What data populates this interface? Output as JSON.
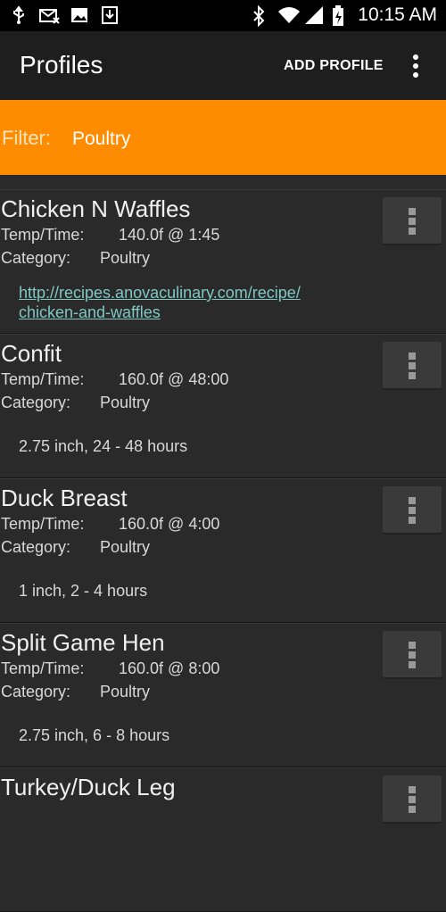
{
  "status_bar": {
    "time": "10:15 AM",
    "left_icons": [
      "usb-icon",
      "mail-icon",
      "image-icon",
      "download-icon"
    ],
    "right_icons": [
      "bluetooth-icon",
      "wifi-icon",
      "signal-icon",
      "battery-icon"
    ]
  },
  "action_bar": {
    "title": "Profiles",
    "add_label": "ADD PROFILE"
  },
  "filter": {
    "label": "Filter:",
    "value": "Poultry"
  },
  "profiles": [
    {
      "name": "Chicken N Waffles",
      "temp_time_label": "Temp/Time:",
      "temp_time": "140.0f @ 1:45",
      "category_label": "Category:",
      "category": "Poultry",
      "link": "http://recipes.anovaculinary.com/recipe/ chicken-and-waffles"
    },
    {
      "name": "Confit",
      "temp_time_label": "Temp/Time:",
      "temp_time": "160.0f @ 48:00",
      "category_label": "Category:",
      "category": "Poultry",
      "note": "2.75 inch, 24 - 48 hours"
    },
    {
      "name": "Duck Breast",
      "temp_time_label": "Temp/Time:",
      "temp_time": "160.0f @ 4:00",
      "category_label": "Category:",
      "category": "Poultry",
      "note": "1 inch, 2 - 4 hours"
    },
    {
      "name": "Split Game Hen",
      "temp_time_label": "Temp/Time:",
      "temp_time": "160.0f @ 8:00",
      "category_label": "Category:",
      "category": "Poultry",
      "note": "2.75 inch, 6 - 8 hours"
    },
    {
      "name": "Turkey/Duck Leg"
    }
  ],
  "colors": {
    "accent": "#ff8c00",
    "background": "#2a2a2a",
    "link": "#7fc7c3"
  }
}
